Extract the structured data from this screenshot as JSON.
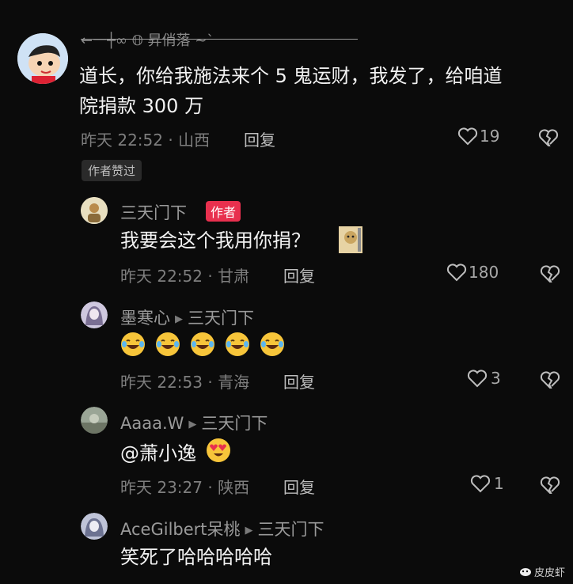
{
  "comments": [
    {
      "user": "←一┼∞ 𝕆 昇俏落 ~`",
      "text_line1": "道长，你给我施法来个 5 鬼运财，我发了，给咱道",
      "text_line2": "院捐款 300 万",
      "time_location": "昨天 22:52 · 山西",
      "reply_label": "回复",
      "likes": "19",
      "tag": "作者赞过"
    },
    {
      "user": "三天门下",
      "badge": "作者",
      "text": "我要会这个我用你捐？",
      "time_location": "昨天 22:52 · 甘肃",
      "reply_label": "回复",
      "likes": "180"
    },
    {
      "user": "墨寒心",
      "reply_to": "三天门下",
      "text": "",
      "emoji_count": 5,
      "time_location": "昨天 22:53 · 青海",
      "reply_label": "回复",
      "likes": "3"
    },
    {
      "user": "Aaaa.W",
      "reply_to": "三天门下",
      "text": "@萧小逸",
      "time_location": "昨天 23:27 · 陕西",
      "reply_label": "回复",
      "likes": "1"
    },
    {
      "user": "AceGilbert呆桃",
      "reply_to": "三天门下",
      "text": "笑死了哈哈哈哈哈"
    }
  ],
  "watermark": "皮皮虾",
  "icons": {
    "like": "heart-outline-icon",
    "dislike": "broken-heart-icon",
    "arrow": "reply-arrow-icon",
    "laugh": "laughing-emoji-icon",
    "hearteyes": "heart-eyes-emoji-icon"
  },
  "colors": {
    "badge": "#e8304e",
    "background": "#0b0b0b"
  }
}
